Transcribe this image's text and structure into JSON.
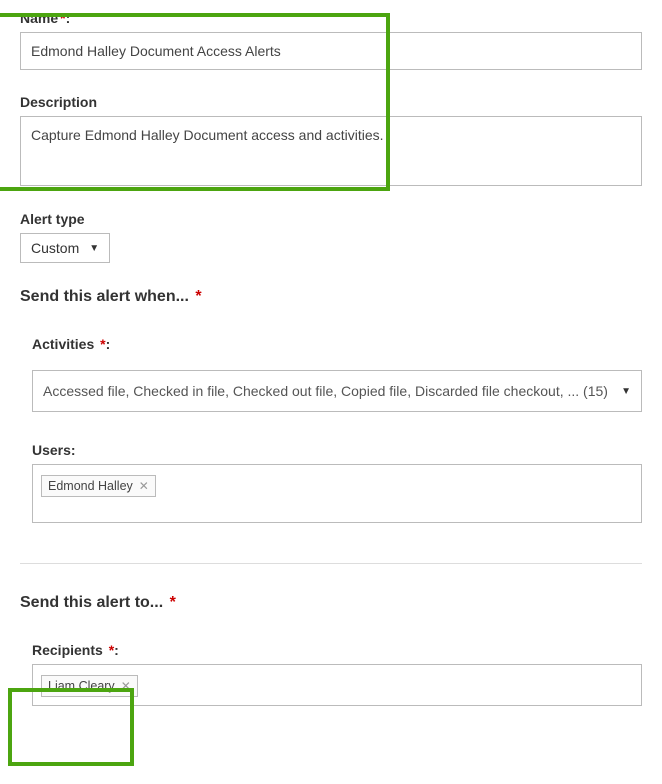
{
  "name": {
    "label": "Name",
    "value": "Edmond Halley Document Access Alerts"
  },
  "description": {
    "label": "Description",
    "value": "Capture Edmond Halley Document access and activities."
  },
  "alertType": {
    "label": "Alert type",
    "selected": "Custom"
  },
  "sendWhenHeading": "Send this alert when...",
  "activities": {
    "label": "Activities",
    "summary": "Accessed file,  Checked in file,  Checked out file,  Copied file,  Discarded file checkout, ... (15)"
  },
  "users": {
    "label": "Users:",
    "chips": [
      "Edmond Halley"
    ]
  },
  "sendToHeading": "Send this alert to...",
  "recipients": {
    "label": "Recipients",
    "chips": [
      "Liam Cleary"
    ]
  }
}
